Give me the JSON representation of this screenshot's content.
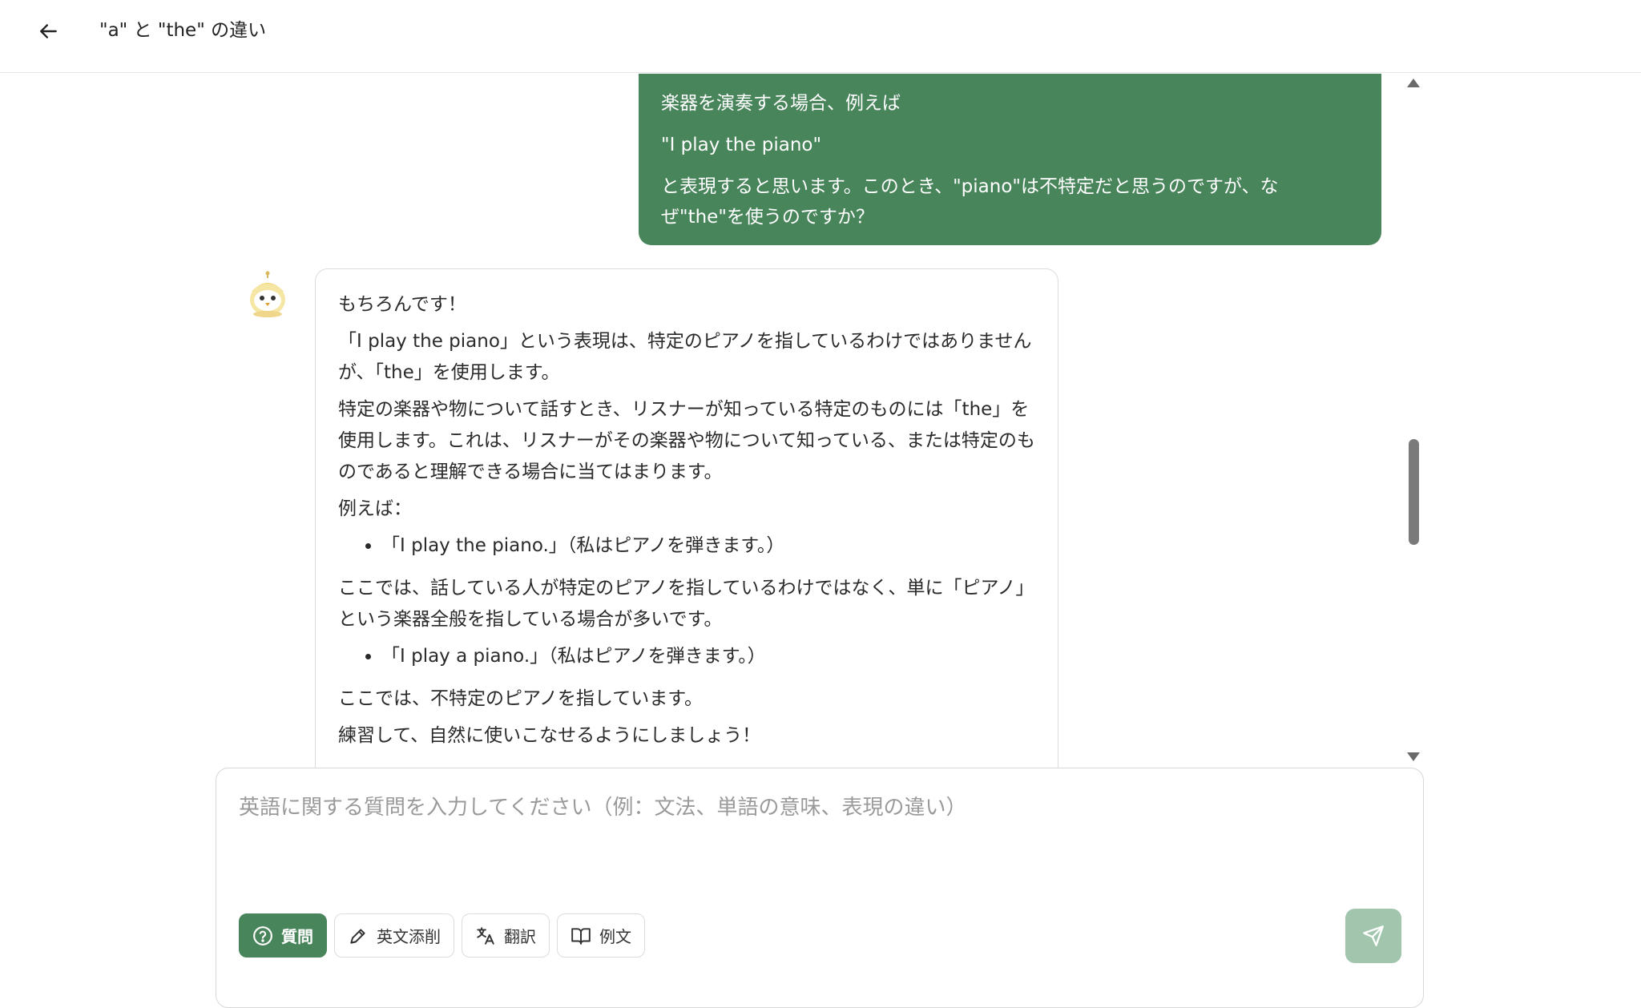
{
  "header": {
    "title": "\"a\" と \"the\" の違い",
    "back_icon": "arrow-left-icon"
  },
  "messages": {
    "user": {
      "lines": [
        "楽器を演奏する場合、例えば",
        "\"I play the piano\"",
        "と表現すると思います。このとき、\"piano\"は不特定だと思うのですが、なぜ\"the\"を使うのですか？"
      ]
    },
    "bot": {
      "avatar_icon": "owl-mascot-icon",
      "intro": "もちろんです！",
      "p1": "「I play the piano」という表現は、特定のピアノを指しているわけではありませんが、「the」を使用します。",
      "p2": "特定の楽器や物について話すとき、リスナーが知っている特定のものには「the」を使用します。これは、リスナーがその楽器や物について知っている、または特定のものであると理解できる場合に当てはまります。",
      "example_label": "例えば：",
      "example1": "「I play the piano.」（私はピアノを弾きます。）",
      "p3": "ここでは、話している人が特定のピアノを指しているわけではなく、単に「ピアノ」という楽器全般を指している場合が多いです。",
      "example2": "「I play a piano.」（私はピアノを弾きます。）",
      "p4": "ここでは、不特定のピアノを指しています。",
      "closing": "練習して、自然に使いこなせるようにしましょう！"
    }
  },
  "composer": {
    "placeholder": "英語に関する質問を入力してください（例：文法、単語の意味、表現の違い）",
    "value": "",
    "modes": [
      {
        "label": "質問",
        "icon": "question-circle-icon",
        "active": true
      },
      {
        "label": "英文添削",
        "icon": "pen-edit-icon",
        "active": false
      },
      {
        "label": "翻訳",
        "icon": "translate-icon",
        "active": false
      },
      {
        "label": "例文",
        "icon": "book-open-icon",
        "active": false
      }
    ],
    "send_icon": "send-icon"
  },
  "colors": {
    "accent": "#48855b",
    "send_disabled": "#a2c6ad",
    "border": "#dcdcdc"
  }
}
